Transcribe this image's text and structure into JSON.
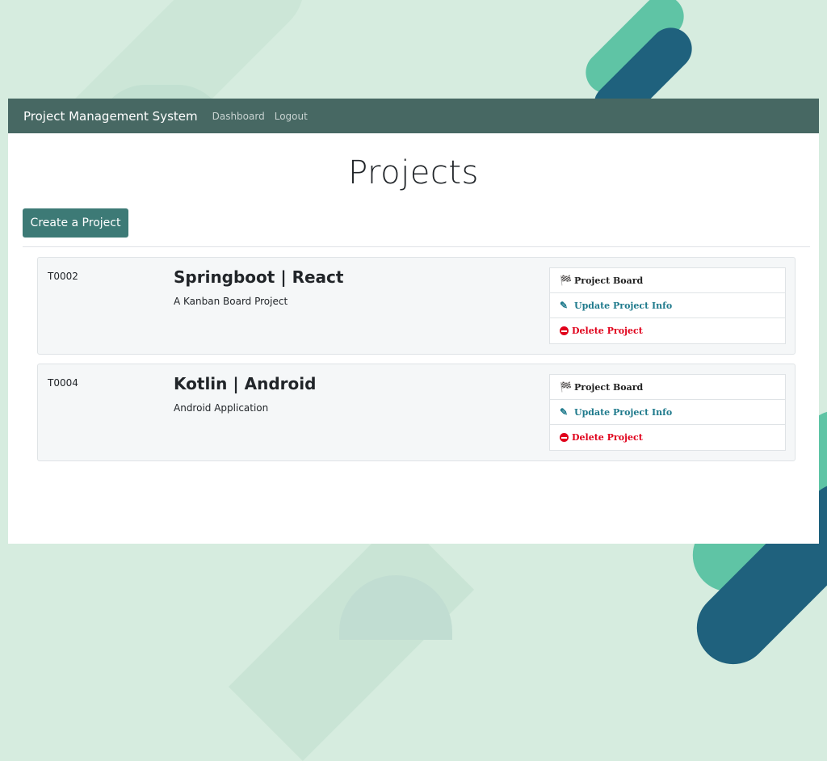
{
  "navbar": {
    "brand": "Project Management System",
    "links": [
      "Dashboard",
      "Logout"
    ]
  },
  "page": {
    "title": "Projects",
    "create_button": "Create a Project"
  },
  "projects": [
    {
      "id": "T0002",
      "name": "Springboot | React",
      "description": "A Kanban Board Project",
      "actions": {
        "board": "Project Board",
        "update": "Update Project Info",
        "delete": "Delete Project"
      }
    },
    {
      "id": "T0004",
      "name": "Kotlin | Android",
      "description": "Android Application",
      "actions": {
        "board": "Project Board",
        "update": "Update Project Info",
        "delete": "Delete Project"
      }
    }
  ],
  "colors": {
    "navbar": "#476863",
    "primary_button": "#3d7a76",
    "update_link": "#1f7a8c",
    "delete_link": "#e0001b",
    "background": "#d6ecdf"
  },
  "icons": {
    "board": "flag-checkered-icon",
    "update": "edit-icon",
    "delete": "minus-circle-icon"
  }
}
